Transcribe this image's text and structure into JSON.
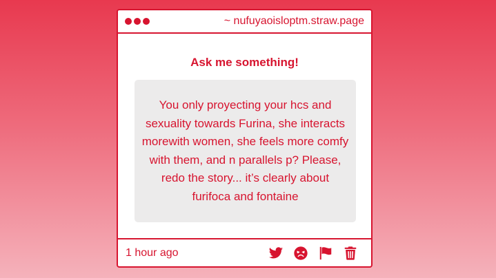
{
  "window": {
    "url": "~ nufuyaoisloptm.straw.page"
  },
  "main": {
    "heading": "Ask me something!",
    "question": "You only proyecting your hcs and sexuality towards Furina, she interacts morewith women, she feels more comfy with them, and n parallels p? Please, redo the story... it’s clearly about furifoca and fontaine"
  },
  "footer": {
    "timestamp": "1 hour ago",
    "actions": [
      {
        "name": "twitter-share",
        "icon": "twitter-icon"
      },
      {
        "name": "angry-react",
        "icon": "angry-face-icon"
      },
      {
        "name": "report",
        "icon": "flag-icon"
      },
      {
        "name": "delete",
        "icon": "trash-icon"
      }
    ]
  },
  "colors": {
    "accent": "#d7142f",
    "background_top": "#e8394f",
    "background_bottom": "#f5b2bb",
    "question_bg": "#ecebeb"
  }
}
